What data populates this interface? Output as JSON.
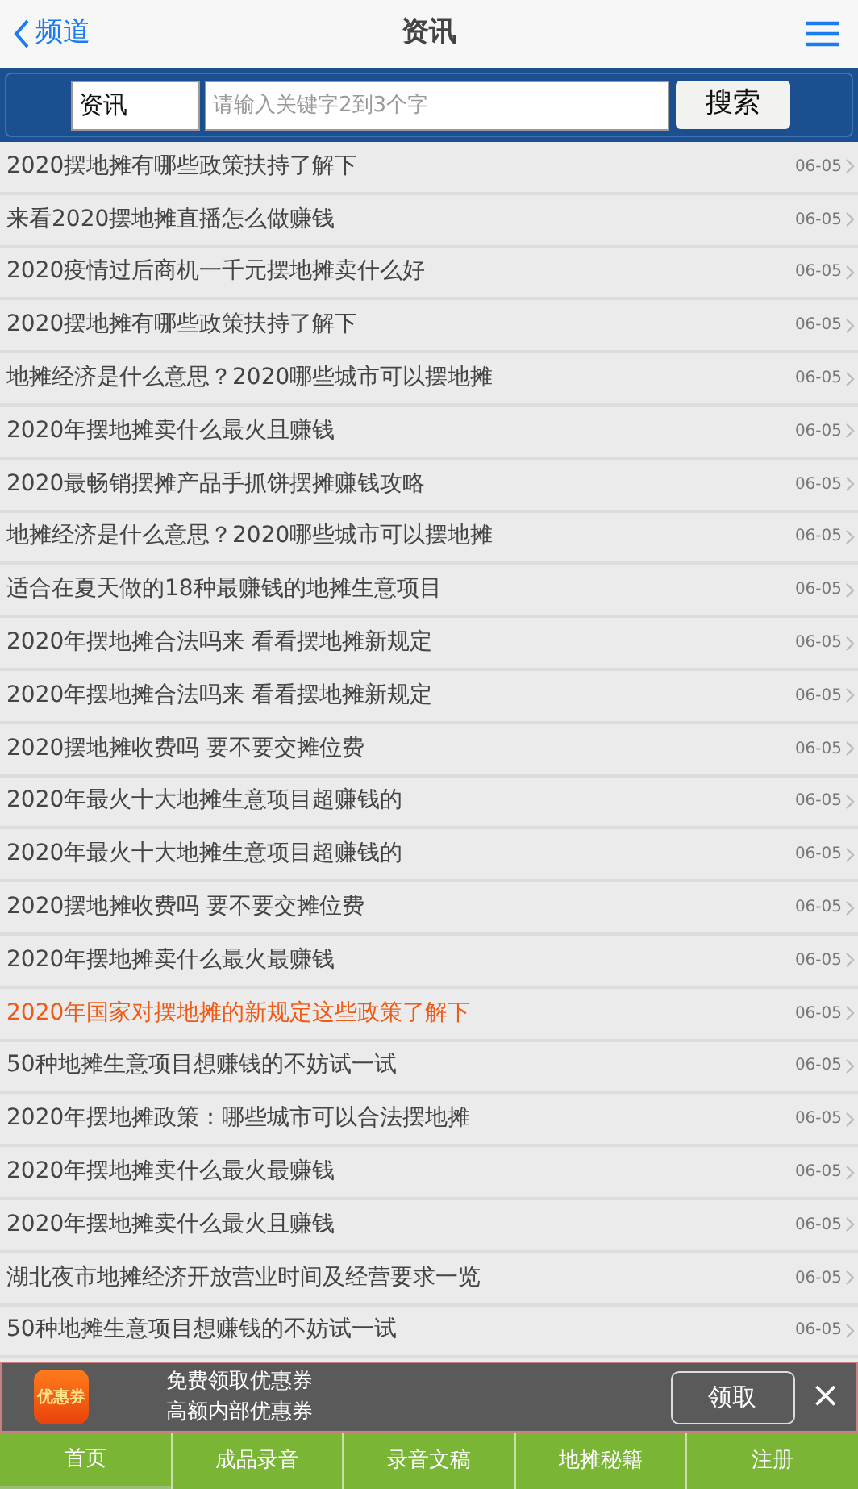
{
  "header": {
    "back_label": "频道",
    "title": "资讯"
  },
  "search": {
    "category": "资讯",
    "placeholder": "请输入关键字2到3个字",
    "button": "搜索"
  },
  "articles": [
    {
      "title": "2020摆地摊有哪些政策扶持了解下",
      "date": "06-05",
      "highlighted": false
    },
    {
      "title": "来看2020摆地摊直播怎么做赚钱",
      "date": "06-05",
      "highlighted": false
    },
    {
      "title": "2020疫情过后商机一千元摆地摊卖什么好",
      "date": "06-05",
      "highlighted": false
    },
    {
      "title": "2020摆地摊有哪些政策扶持了解下",
      "date": "06-05",
      "highlighted": false
    },
    {
      "title": "地摊经济是什么意思？2020哪些城市可以摆地摊",
      "date": "06-05",
      "highlighted": false
    },
    {
      "title": "2020年摆地摊卖什么最火且赚钱",
      "date": "06-05",
      "highlighted": false
    },
    {
      "title": "2020最畅销摆摊产品手抓饼摆摊赚钱攻略",
      "date": "06-05",
      "highlighted": false
    },
    {
      "title": "地摊经济是什么意思？2020哪些城市可以摆地摊",
      "date": "06-05",
      "highlighted": false
    },
    {
      "title": "适合在夏天做的18种最赚钱的地摊生意项目",
      "date": "06-05",
      "highlighted": false
    },
    {
      "title": "2020年摆地摊合法吗来 看看摆地摊新规定",
      "date": "06-05",
      "highlighted": false
    },
    {
      "title": "2020年摆地摊合法吗来 看看摆地摊新规定",
      "date": "06-05",
      "highlighted": false
    },
    {
      "title": "2020摆地摊收费吗 要不要交摊位费",
      "date": "06-05",
      "highlighted": false
    },
    {
      "title": "2020年最火十大地摊生意项目超赚钱的",
      "date": "06-05",
      "highlighted": false
    },
    {
      "title": "2020年最火十大地摊生意项目超赚钱的",
      "date": "06-05",
      "highlighted": false
    },
    {
      "title": "2020摆地摊收费吗 要不要交摊位费",
      "date": "06-05",
      "highlighted": false
    },
    {
      "title": "2020年摆地摊卖什么最火最赚钱",
      "date": "06-05",
      "highlighted": false
    },
    {
      "title": "2020年国家对摆地摊的新规定这些政策了解下",
      "date": "06-05",
      "highlighted": true
    },
    {
      "title": "50种地摊生意项目想赚钱的不妨试一试",
      "date": "06-05",
      "highlighted": false
    },
    {
      "title": "2020年摆地摊政策：哪些城市可以合法摆地摊",
      "date": "06-05",
      "highlighted": false
    },
    {
      "title": "2020年摆地摊卖什么最火最赚钱",
      "date": "06-05",
      "highlighted": false
    },
    {
      "title": "2020年摆地摊卖什么最火且赚钱",
      "date": "06-05",
      "highlighted": false
    },
    {
      "title": "湖北夜市地摊经济开放营业时间及经营要求一览",
      "date": "06-05",
      "highlighted": false
    },
    {
      "title": "50种地摊生意项目想赚钱的不妨试一试",
      "date": "06-05",
      "highlighted": false
    }
  ],
  "banner": {
    "app_icon_text": "优惠券",
    "line_1": "免费领取优惠券",
    "line_2": "高额内部优惠券",
    "button": "领取",
    "close": "×"
  },
  "tabs": [
    {
      "label": "首页",
      "selected": true
    },
    {
      "label": "成品录音",
      "selected": false
    },
    {
      "label": "录音文稿",
      "selected": false
    },
    {
      "label": "地摊秘籍",
      "selected": false
    },
    {
      "label": "注册",
      "selected": false
    }
  ]
}
